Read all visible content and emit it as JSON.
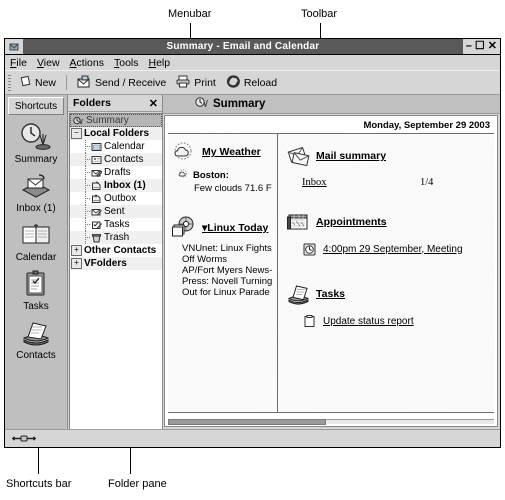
{
  "annotations": [
    {
      "label": "Menubar"
    },
    {
      "label": "Toolbar"
    },
    {
      "label": "Shortcuts bar"
    },
    {
      "label": "Folder pane"
    }
  ],
  "window": {
    "title": "Summary - Email and Calendar",
    "controls": {
      "minimize": "–",
      "maximize": "☐",
      "close": "✕"
    },
    "app_icon": "evolution-icon"
  },
  "menubar": {
    "items": [
      {
        "label": "File",
        "mnemonic": "F"
      },
      {
        "label": "View",
        "mnemonic": "V"
      },
      {
        "label": "Actions",
        "mnemonic": "A"
      },
      {
        "label": "Tools",
        "mnemonic": "T"
      },
      {
        "label": "Help",
        "mnemonic": "H"
      }
    ]
  },
  "toolbar": {
    "buttons": [
      {
        "label": "New",
        "icon": "new-document-icon"
      },
      {
        "label": "Send / Receive",
        "icon": "send-receive-icon"
      },
      {
        "label": "Print",
        "icon": "printer-icon"
      },
      {
        "label": "Reload",
        "icon": "reload-icon"
      }
    ]
  },
  "shortcuts_bar": {
    "header": "Shortcuts",
    "items": [
      {
        "label": "Summary",
        "icon": "summary-icon",
        "selected": true
      },
      {
        "label": "Inbox (1)",
        "icon": "inbox-icon",
        "selected": false
      },
      {
        "label": "Calendar",
        "icon": "calendar-icon",
        "selected": false
      },
      {
        "label": "Tasks",
        "icon": "tasks-icon",
        "selected": false
      },
      {
        "label": "Contacts",
        "icon": "contacts-icon",
        "selected": false
      }
    ]
  },
  "folder_pane": {
    "header": "Folders",
    "close_label": "✕",
    "tree": [
      {
        "label": "Summary",
        "icon": "summary-icon",
        "indent": 0,
        "expander": "",
        "selected": true,
        "bold": false
      },
      {
        "label": "Local Folders",
        "icon": "",
        "indent": 0,
        "expander": "−",
        "selected": false,
        "bold": true
      },
      {
        "label": "Calendar",
        "icon": "calendar-folder-icon",
        "indent": 1,
        "expander": "",
        "selected": false,
        "bold": false
      },
      {
        "label": "Contacts",
        "icon": "contacts-folder-icon",
        "indent": 1,
        "expander": "",
        "selected": false,
        "bold": false
      },
      {
        "label": "Drafts",
        "icon": "drafts-folder-icon",
        "indent": 1,
        "expander": "",
        "selected": false,
        "bold": false
      },
      {
        "label": "Inbox (1)",
        "icon": "inbox-folder-icon",
        "indent": 1,
        "expander": "",
        "selected": false,
        "bold": true
      },
      {
        "label": "Outbox",
        "icon": "outbox-folder-icon",
        "indent": 1,
        "expander": "",
        "selected": false,
        "bold": false
      },
      {
        "label": "Sent",
        "icon": "sent-folder-icon",
        "indent": 1,
        "expander": "",
        "selected": false,
        "bold": false
      },
      {
        "label": "Tasks",
        "icon": "tasks-folder-icon",
        "indent": 1,
        "expander": "",
        "selected": false,
        "bold": false
      },
      {
        "label": "Trash",
        "icon": "trash-folder-icon",
        "indent": 1,
        "expander": "",
        "selected": false,
        "bold": false
      },
      {
        "label": "Other Contacts",
        "icon": "",
        "indent": 0,
        "expander": "+",
        "selected": false,
        "bold": true
      },
      {
        "label": "VFolders",
        "icon": "",
        "indent": 0,
        "expander": "+",
        "selected": false,
        "bold": true
      }
    ]
  },
  "main": {
    "header_title": "Summary",
    "header_icon": "summary-icon",
    "date": "Monday, September 29 2003",
    "weather": {
      "title": "My Weather",
      "icon": "weather-cloud-icon",
      "city_icon": "weather-small-icon",
      "city": "Boston:",
      "conditions": "Few clouds 71.6 F"
    },
    "news": {
      "title": "Linux Today",
      "title_prefix": "▾",
      "icon": "rdf-news-icon",
      "headlines": [
        "VNUnet: Linux Fights Off Worms",
        "AP/Fort Myers News-Press: Novell Turning Out for Linux Parade"
      ]
    },
    "mail_summary": {
      "title": "Mail summary",
      "icon": "mail-summary-icon",
      "rows": [
        {
          "folder": "Inbox",
          "count": "1/4"
        }
      ]
    },
    "appointments": {
      "title": "Appointments",
      "icon": "appointments-icon",
      "items": [
        {
          "label": "4:00pm 29 September, Meeting",
          "icon": "clock-icon"
        }
      ]
    },
    "tasks": {
      "title": "Tasks",
      "icon": "tasks-panel-icon",
      "items": [
        {
          "label": "Update status report",
          "icon": "task-checkbox-icon"
        }
      ]
    }
  },
  "statusbar": {
    "handle_icon": "resize-handle-icon"
  },
  "colors": {
    "titlebar_bg": "#595959",
    "chrome_bg": "#d6d6d6",
    "shortcutbar_bg": "#bfbfbf",
    "header_bg": "#c0c0c0",
    "canvas_bg": "#ffffff",
    "rule": "#6d6d6d"
  }
}
